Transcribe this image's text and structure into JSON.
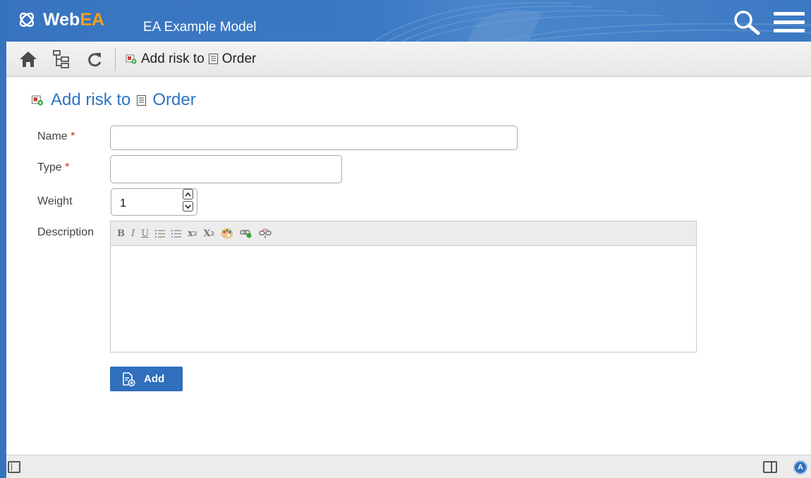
{
  "header": {
    "logo_web": "Web",
    "logo_ea": "EA",
    "model_title": "EA Example Model"
  },
  "toolbar": {
    "breadcrumb_action": "Add risk to",
    "breadcrumb_target": "Order"
  },
  "page": {
    "title_action": "Add risk to",
    "title_target": "Order"
  },
  "form": {
    "name_label": "Name",
    "name_value": "",
    "type_label": "Type",
    "type_value": "",
    "weight_label": "Weight",
    "weight_value": "1",
    "description_label": "Description",
    "required_marker": "*",
    "editor_tools": [
      "B",
      "I",
      "U",
      "ordered-list",
      "unordered-list",
      "x2",
      "X2",
      "color",
      "link",
      "unlink"
    ],
    "add_label": "Add"
  },
  "colors": {
    "brand_blue": "#3574bd",
    "logo_orange": "#f7a01c",
    "title_blue": "#2f74c0",
    "required_red": "#d2291f"
  },
  "icons": {
    "logo": "webea-logo-icon",
    "search": "search-icon",
    "menu": "hamburger-menu-icon",
    "home": "home-icon",
    "tree": "model-tree-icon",
    "refresh": "refresh-icon",
    "risk": "add-risk-icon",
    "element": "document-element-icon",
    "add": "add-document-icon"
  }
}
